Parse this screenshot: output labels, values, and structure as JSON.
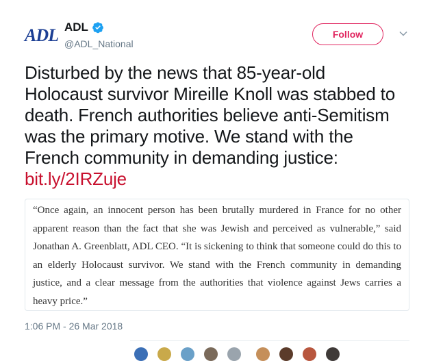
{
  "account": {
    "logo_text": "ADL",
    "display_name": "ADL",
    "handle": "@ADL_National",
    "verified": true
  },
  "actions": {
    "follow_label": "Follow",
    "more_icon": "chevron-down-icon"
  },
  "tweet": {
    "text": "Disturbed by the news that 85-year-old Holocaust survivor Mireille Knoll was stabbed to death. French authorities believe anti-Semitism was the primary motive. We stand with the French community in demanding justice: ",
    "link": "bit.ly/2IRZuje",
    "quote": "“Once again, an innocent person has been brutally murdered in France for no other apparent reason than the fact that she was Jewish and perceived as vulnerable,” said Jonathan A. Greenblatt, ADL CEO. “It is sickening to think that someone could do this to an elderly Holocaust survivor. We stand with the French community in demanding justice, and a clear message from the authorities that violence against Jews carries a heavy price.”",
    "timestamp": "1:06 PM - 26 Mar 2018"
  },
  "colors": {
    "follow_accent": "#e0245e",
    "link": "#c8102e",
    "logo": "#1c3f94",
    "verified": "#1da1f2"
  }
}
